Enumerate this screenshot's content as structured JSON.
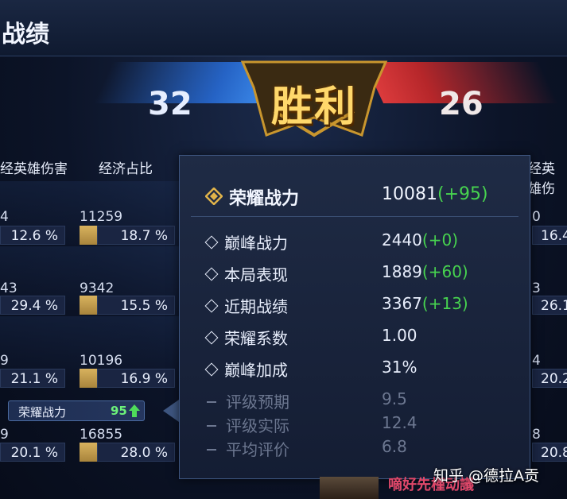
{
  "header": {
    "title": "战绩"
  },
  "match": {
    "score_left": "32",
    "score_right": "26",
    "result": "胜利"
  },
  "columns": {
    "left_col1": "经英雄伤害",
    "left_col2": "经济占比",
    "right_col1": "经英雄伤"
  },
  "rows": [
    {
      "dmg_num": "4",
      "dmg_pct": "12.6 %",
      "gold_num": "11259",
      "gold_pct": "18.7 %",
      "right_num": "0",
      "right_pct": "16.4"
    },
    {
      "dmg_num": "43",
      "dmg_pct": "29.4 %",
      "gold_num": "9342",
      "gold_pct": "15.5 %",
      "right_num": "3",
      "right_pct": "26.1"
    },
    {
      "dmg_num": "9",
      "dmg_pct": "21.1 %",
      "gold_num": "10196",
      "gold_pct": "16.9 %",
      "right_num": "4",
      "right_pct": "20.2"
    },
    {
      "dmg_num": "9",
      "dmg_pct": "20.1 %",
      "gold_num": "16855",
      "gold_pct": "28.0 %",
      "right_num": "8",
      "right_pct": "20.8"
    }
  ],
  "honor_chip": {
    "label": "荣耀战力",
    "value": "95"
  },
  "tooltip": {
    "header": {
      "label": "荣耀战力",
      "value": "10081",
      "delta": "(+95)"
    },
    "items": [
      {
        "label": "巅峰战力",
        "value": "2440",
        "delta": "(+0)"
      },
      {
        "label": "本局表现",
        "value": "1889",
        "delta": "(+60)"
      },
      {
        "label": "近期战绩",
        "value": "3367",
        "delta": "(+13)"
      },
      {
        "label": "荣耀系数",
        "value": "1.00",
        "delta": ""
      },
      {
        "label": "巅峰加成",
        "value": "31%",
        "delta": ""
      }
    ],
    "disabled_items": [
      {
        "label": "评级预期",
        "value": "9.5"
      },
      {
        "label": "评级实际",
        "value": "12.4"
      },
      {
        "label": "平均评价",
        "value": "6.8"
      }
    ]
  },
  "watermark": "知乎 @德拉A贡",
  "bottom_player_name": "嘀好先槿动議",
  "colors": {
    "gain": "#47d34f",
    "gold": "#ffd86b",
    "blue_team": "#2e78e0",
    "red_team": "#d83838"
  }
}
